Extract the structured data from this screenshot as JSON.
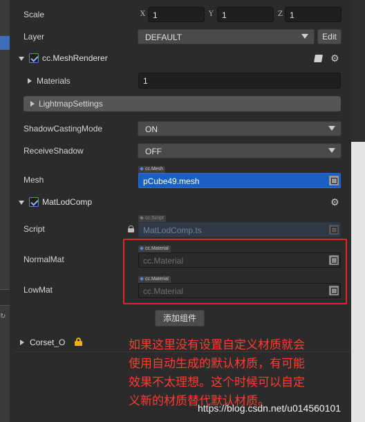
{
  "transform": {
    "scale_label": "Scale",
    "x_axis": "X",
    "x_value": "1",
    "y_axis": "Y",
    "y_value": "1",
    "z_axis": "Z",
    "z_value": "1",
    "layer_label": "Layer",
    "layer_value": "DEFAULT",
    "edit_label": "Edit"
  },
  "mesh_renderer": {
    "title": "cc.MeshRenderer",
    "materials_label": "Materials",
    "materials_count": "1",
    "lightmap_label": "LightmapSettings",
    "shadow_casting_label": "ShadowCastingMode",
    "shadow_casting_value": "ON",
    "receive_shadow_label": "ReceiveShadow",
    "receive_shadow_value": "OFF",
    "mesh_label": "Mesh",
    "mesh_tag": "cc.Mesh",
    "mesh_value": "pCube49.mesh"
  },
  "mat_lod_comp": {
    "title": "MatLodComp",
    "script_label": "Script",
    "script_tag": "cc.Script",
    "script_value": "MatLodComp.ts",
    "normal_mat_label": "NormalMat",
    "normal_mat_tag": "cc.Material",
    "normal_mat_placeholder": "cc.Material",
    "low_mat_label": "LowMat",
    "low_mat_tag": "cc.Material",
    "low_mat_placeholder": "cc.Material"
  },
  "add_component_label": "添加组件",
  "corset": {
    "title": "Corset_O"
  },
  "annotation": {
    "line1": "如果这里没有设置自定义材质就会",
    "line2": "使用自动生成的默认材质，有可能",
    "line3": "效果不太理想。这个时候可以自定",
    "line4": "义新的材质替代默认材质。"
  },
  "watermark": "https://blog.csdn.net/u014560101",
  "colors": {
    "highlight_box": "#e8261f",
    "annotation_text": "#ff3b30",
    "mesh_field": "#1a5fc4",
    "checkbox_accent": "#5a88c5"
  }
}
